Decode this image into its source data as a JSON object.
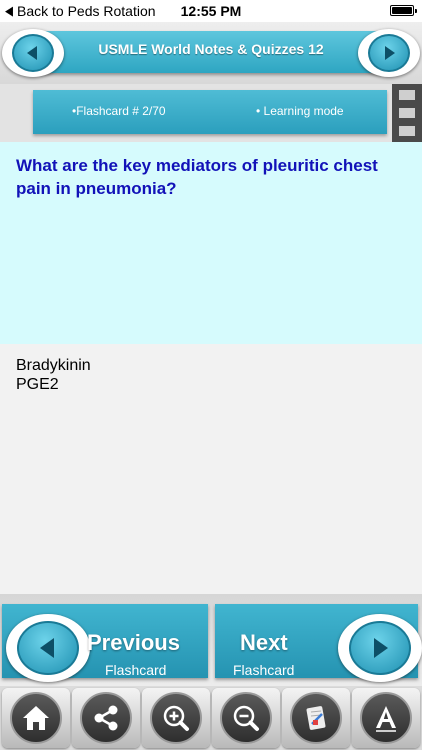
{
  "status_bar": {
    "back_label": "Back to Peds Rotation",
    "time": "12:55 PM"
  },
  "header": {
    "title": "USMLE World Notes & Quizzes 12"
  },
  "info_bar": {
    "flashcard_label": "•Flashcard #  2/70",
    "mode_label": "• Learning mode"
  },
  "question": {
    "text": "What are the key mediators of pleuritic chest pain in pneumonia?"
  },
  "answer": {
    "lines": [
      "Bradykinin",
      "PGE2"
    ]
  },
  "nav": {
    "previous_label": "Previous",
    "previous_sub": "Flashcard",
    "next_label": "Next",
    "next_sub": "Flashcard"
  },
  "toolbar": {
    "icons": [
      "home-icon",
      "share-icon",
      "zoom-in-icon",
      "zoom-out-icon",
      "note-icon",
      "font-size-icon"
    ]
  },
  "colors": {
    "accent": "#2ea6c2",
    "question_bg": "#d6fbfd",
    "question_text": "#1212b8"
  }
}
